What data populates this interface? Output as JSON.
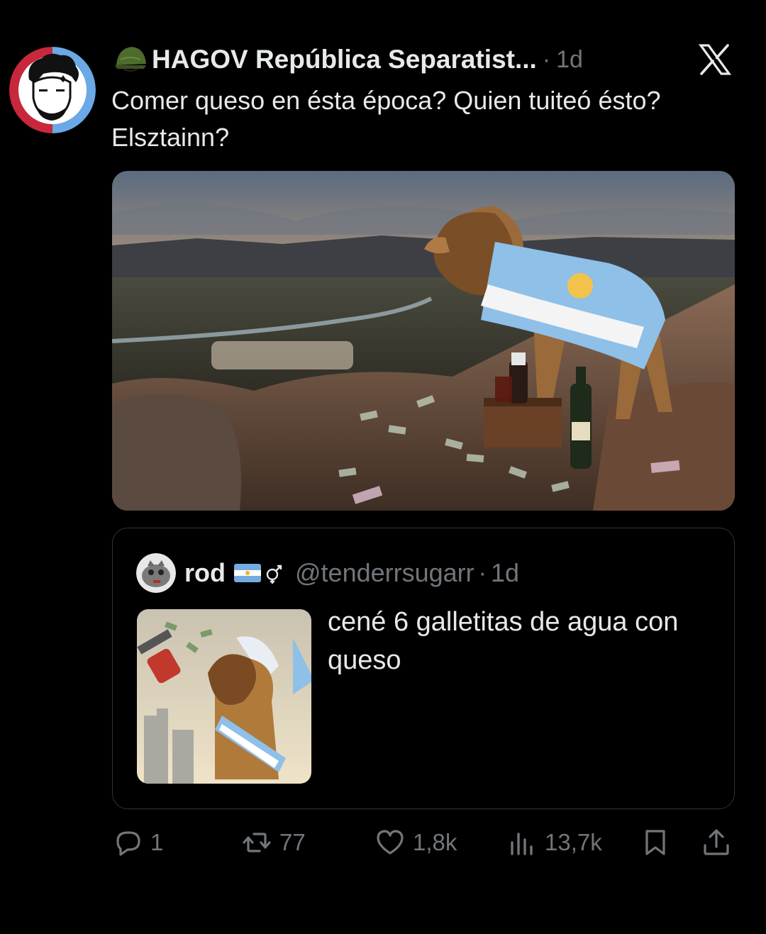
{
  "tweet": {
    "author_name": "HAGOV República Separatist...",
    "time": "1d",
    "text": "Comer queso en ésta época? Quien tuiteó ésto? Elsztainn?",
    "separator": "·"
  },
  "quote": {
    "name": "rod",
    "handle": "@tenderrsugarr",
    "time": "1d",
    "separator": "·",
    "text": "cené 6 galletitas de agua con queso"
  },
  "actions": {
    "replies": "1",
    "reposts": "77",
    "likes": "1,8k",
    "views": "13,7k"
  },
  "icons": {
    "logo": "x-logo-icon",
    "reply": "reply-icon",
    "repost": "repost-icon",
    "like": "heart-icon",
    "views": "views-icon",
    "bookmark": "bookmark-icon",
    "share": "share-icon"
  },
  "colors": {
    "background": "#000000",
    "text": "#e7e9ea",
    "secondary": "#71767b",
    "border": "#2f3336"
  }
}
